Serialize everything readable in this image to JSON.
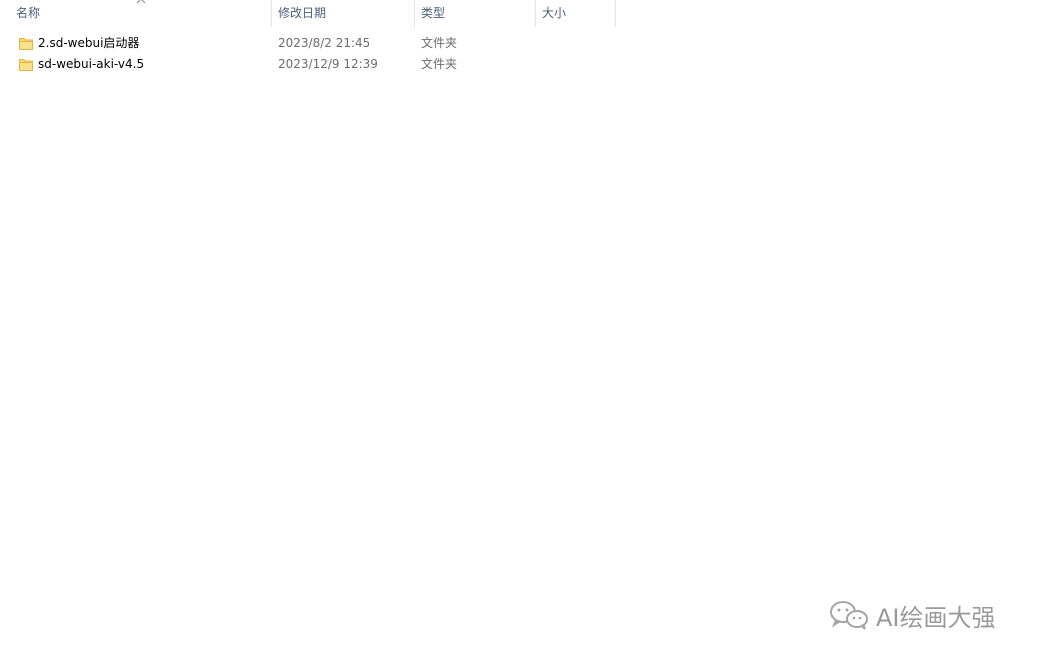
{
  "columns": {
    "name": "名称",
    "date_modified": "修改日期",
    "type": "类型",
    "size": "大小"
  },
  "sort": {
    "column": "name",
    "direction": "ascending",
    "icon": "chevron-up-icon"
  },
  "files": [
    {
      "name": "2.sd-webui启动器",
      "date_modified": "2023/8/2 21:45",
      "type": "文件夹",
      "icon": "folder-icon"
    },
    {
      "name": "sd-webui-aki-v4.5",
      "date_modified": "2023/12/9 12:39",
      "type": "文件夹",
      "icon": "folder-icon"
    }
  ],
  "watermark": {
    "text": "AI绘画大强",
    "icon": "wechat-icon"
  },
  "colors": {
    "header_text": "#4c607a",
    "folder_fill": "#f8d775",
    "folder_edge": "#e0b84a",
    "secondary_text": "#6d6d6d"
  }
}
